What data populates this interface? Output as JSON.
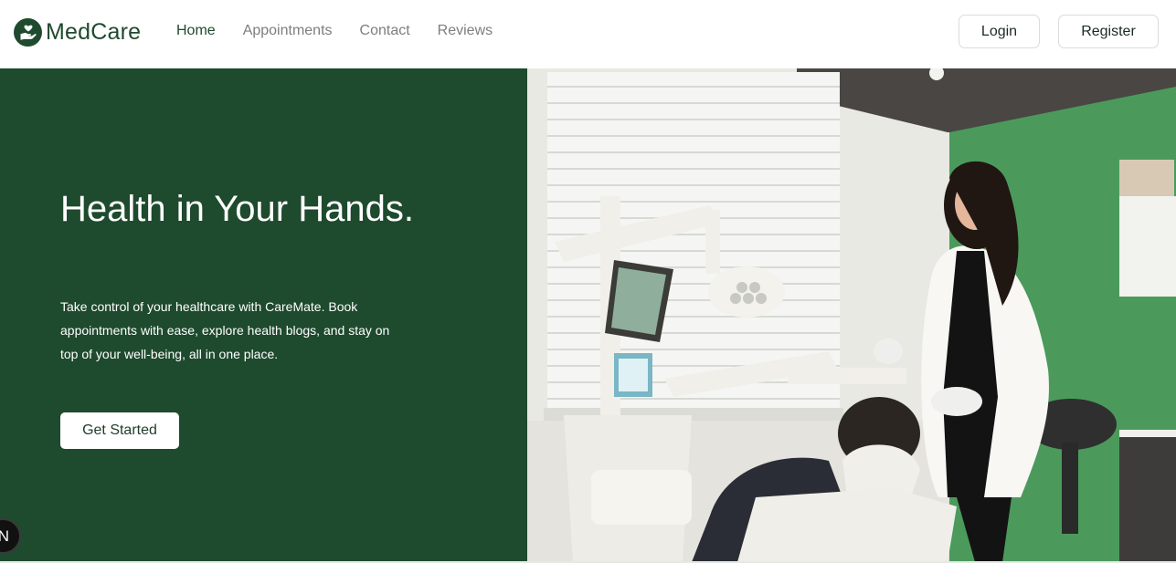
{
  "brand": {
    "name": "MedCare",
    "icon": "heart-hand-icon"
  },
  "nav": {
    "items": [
      {
        "label": "Home",
        "active": true
      },
      {
        "label": "Appointments",
        "active": false
      },
      {
        "label": "Contact",
        "active": false
      },
      {
        "label": "Reviews",
        "active": false
      }
    ]
  },
  "auth": {
    "login_label": "Login",
    "register_label": "Register"
  },
  "hero": {
    "title": "Health in Your Hands.",
    "description": "Take control of your healthcare with CareMate. Book appointments with ease, explore health blogs, and stay on top of your well-being, all in one place.",
    "cta_label": "Get Started",
    "image": "dentist-clinic-photo"
  },
  "badge": {
    "letter": "N"
  },
  "colors": {
    "primary": "#1e4a2e",
    "accent_wall": "#4b9a5c",
    "text_muted": "#7c7f7a"
  }
}
